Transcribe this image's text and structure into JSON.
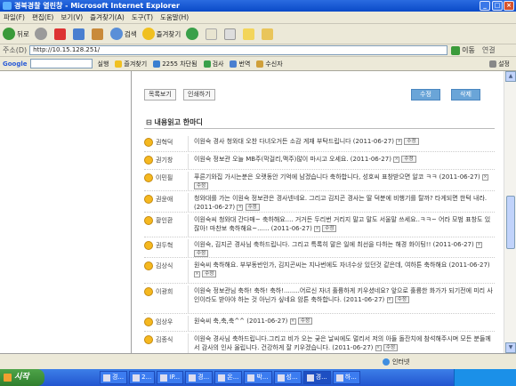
{
  "window": {
    "title": "경북경찰 열린창 - Microsoft Internet Explorer"
  },
  "menu": [
    "파일(F)",
    "편집(E)",
    "보기(V)",
    "즐겨찾기(A)",
    "도구(T)",
    "도움말(H)"
  ],
  "toolbar": {
    "back": "뒤로",
    "search": "검색",
    "favorites": "즐겨찾기"
  },
  "address": {
    "label": "주소(D)",
    "url": "http://10.15.128.251/",
    "go": "이동",
    "links": "연결"
  },
  "google": {
    "label": "Google",
    "items": [
      "실행",
      "즐겨찾기",
      "2255 차단됨",
      "검사",
      "번역",
      "수신자",
      "설정"
    ]
  },
  "board": {
    "list_btn": "목록보기",
    "print_btn": "인쇄하기",
    "edit_btn": "수정",
    "delete_btn": "삭제",
    "section_title": "내용읽고 한마디",
    "edit_label": "수정",
    "comments": [
      {
        "name": "권혁덕",
        "text": "이원숙 경사 청와대 오찬 다녀오거든 소감 게재 부탁드립니다 (2011-06-27)"
      },
      {
        "name": "권기창",
        "text": "이원숙 정보관 오늘 MB주(막걸리,맥주)많이 마시고 오세요. (2011-06-27)"
      },
      {
        "name": "이민필",
        "text": "푸른기와집 가시는분은 오랫동안 기억에 남겠습니다 축하합니다, 성호씨 표창받으면 알코 ㅋㅋ (2011-06-27)"
      },
      {
        "name": "권윤애",
        "text": "청와대를 가는 이원숙 정보관은 경사넨네요. 그리고 김지곤 경사는 딸 덕분에 비행기를 탈까? 타게되면 한턱 내라. (2011-06-27)"
      },
      {
        "name": "황인환",
        "text": "이원숙씨 청와대 간다매~ 축하해요.... 거거든 두리번 거리지 말고 말도 서울말 쓰세요..ㅋㅋ~ 어라 모범 표창도 있잖아! 마찬보 축하해요~...... (2011-06-27)"
      },
      {
        "name": "권두혁",
        "text": "이원숙, 김지곤 경사님 축하드립니다. 그리고 특록히 말은 일에 최선을 다하는 해경 화이팅!! (2011-06-27)"
      },
      {
        "name": "김상식",
        "text": "원숙씨 축하해요. 부부동반인가, 김지곤씨는 지나번에도 자녀수상 있던것 같은데, 여하튼 축하해요 (2011-06-27)"
      },
      {
        "name": "이광희",
        "text": "이원숙 정보관님 축하! 축하! 축하!........어르신 자녀 훌륭하게 키우셨네요? 앞으로 훌륭한 화가가 되기전에 미리 사인이라도 받아야 하는 것 아닌가 싶네요 암튼 축하합니다. (2011-06-27)"
      },
      {
        "name": "임상우",
        "text": "원숙씨 축,축,축^^ (2011-06-27)"
      },
      {
        "name": "김종식",
        "text": "이원숙 경사님 축하드립니다.그리고 비가 오는 궂은 날씨에도 멀리서 저의 아들 돌잔치에 참석해주시며 모든 분들께서 감사의 인사 올립니다. 건강하게 잘 키우겠습니다. (2011-06-27)"
      }
    ]
  },
  "status": {
    "zone": "인터넷"
  },
  "taskbar": {
    "start": "시작",
    "tasks": [
      "경...",
      "2...",
      "IP...",
      "경...",
      "온...",
      "박...",
      "성...",
      "경...",
      "하..."
    ]
  },
  "colors": {
    "accent": "#6aa5d8",
    "titlebar": "#0a4ac8",
    "start": "#307f2e"
  }
}
